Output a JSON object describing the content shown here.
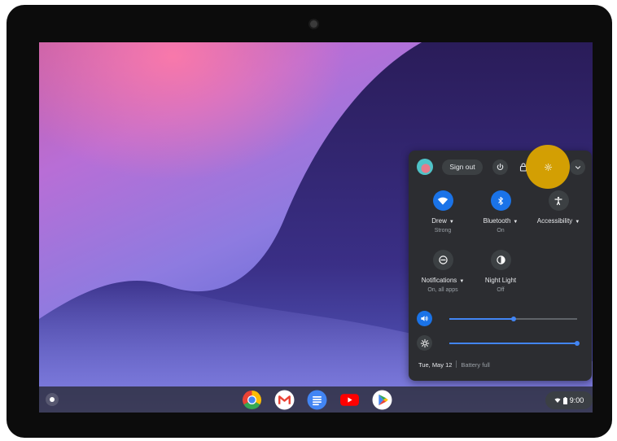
{
  "quick_settings": {
    "sign_out_label": "Sign out",
    "tiles": [
      {
        "label": "Drew",
        "sub": "Strong",
        "icon": "wifi-icon",
        "state": "on"
      },
      {
        "label": "Bluetooth",
        "sub": "On",
        "icon": "bluetooth-icon",
        "state": "on"
      },
      {
        "label": "Accessibility",
        "sub": "",
        "icon": "accessibility-icon",
        "state": "off"
      },
      {
        "label": "Notifications",
        "sub": "On, all apps",
        "icon": "notifications-icon",
        "state": "off"
      },
      {
        "label": "Night Light",
        "sub": "Off",
        "icon": "night-light-icon",
        "state": "off"
      }
    ],
    "volume_level": 0.5,
    "brightness_level": 1.0,
    "date": "Tue, May 12",
    "battery": "Battery full"
  },
  "shelf": {
    "apps": [
      "chrome-icon",
      "gmail-icon",
      "docs-icon",
      "youtube-icon",
      "play-store-icon"
    ],
    "status_time": "9:00"
  },
  "colors": {
    "accent": "#1a73e8",
    "highlight": "#e0a800",
    "panel": "#2c2d31"
  }
}
